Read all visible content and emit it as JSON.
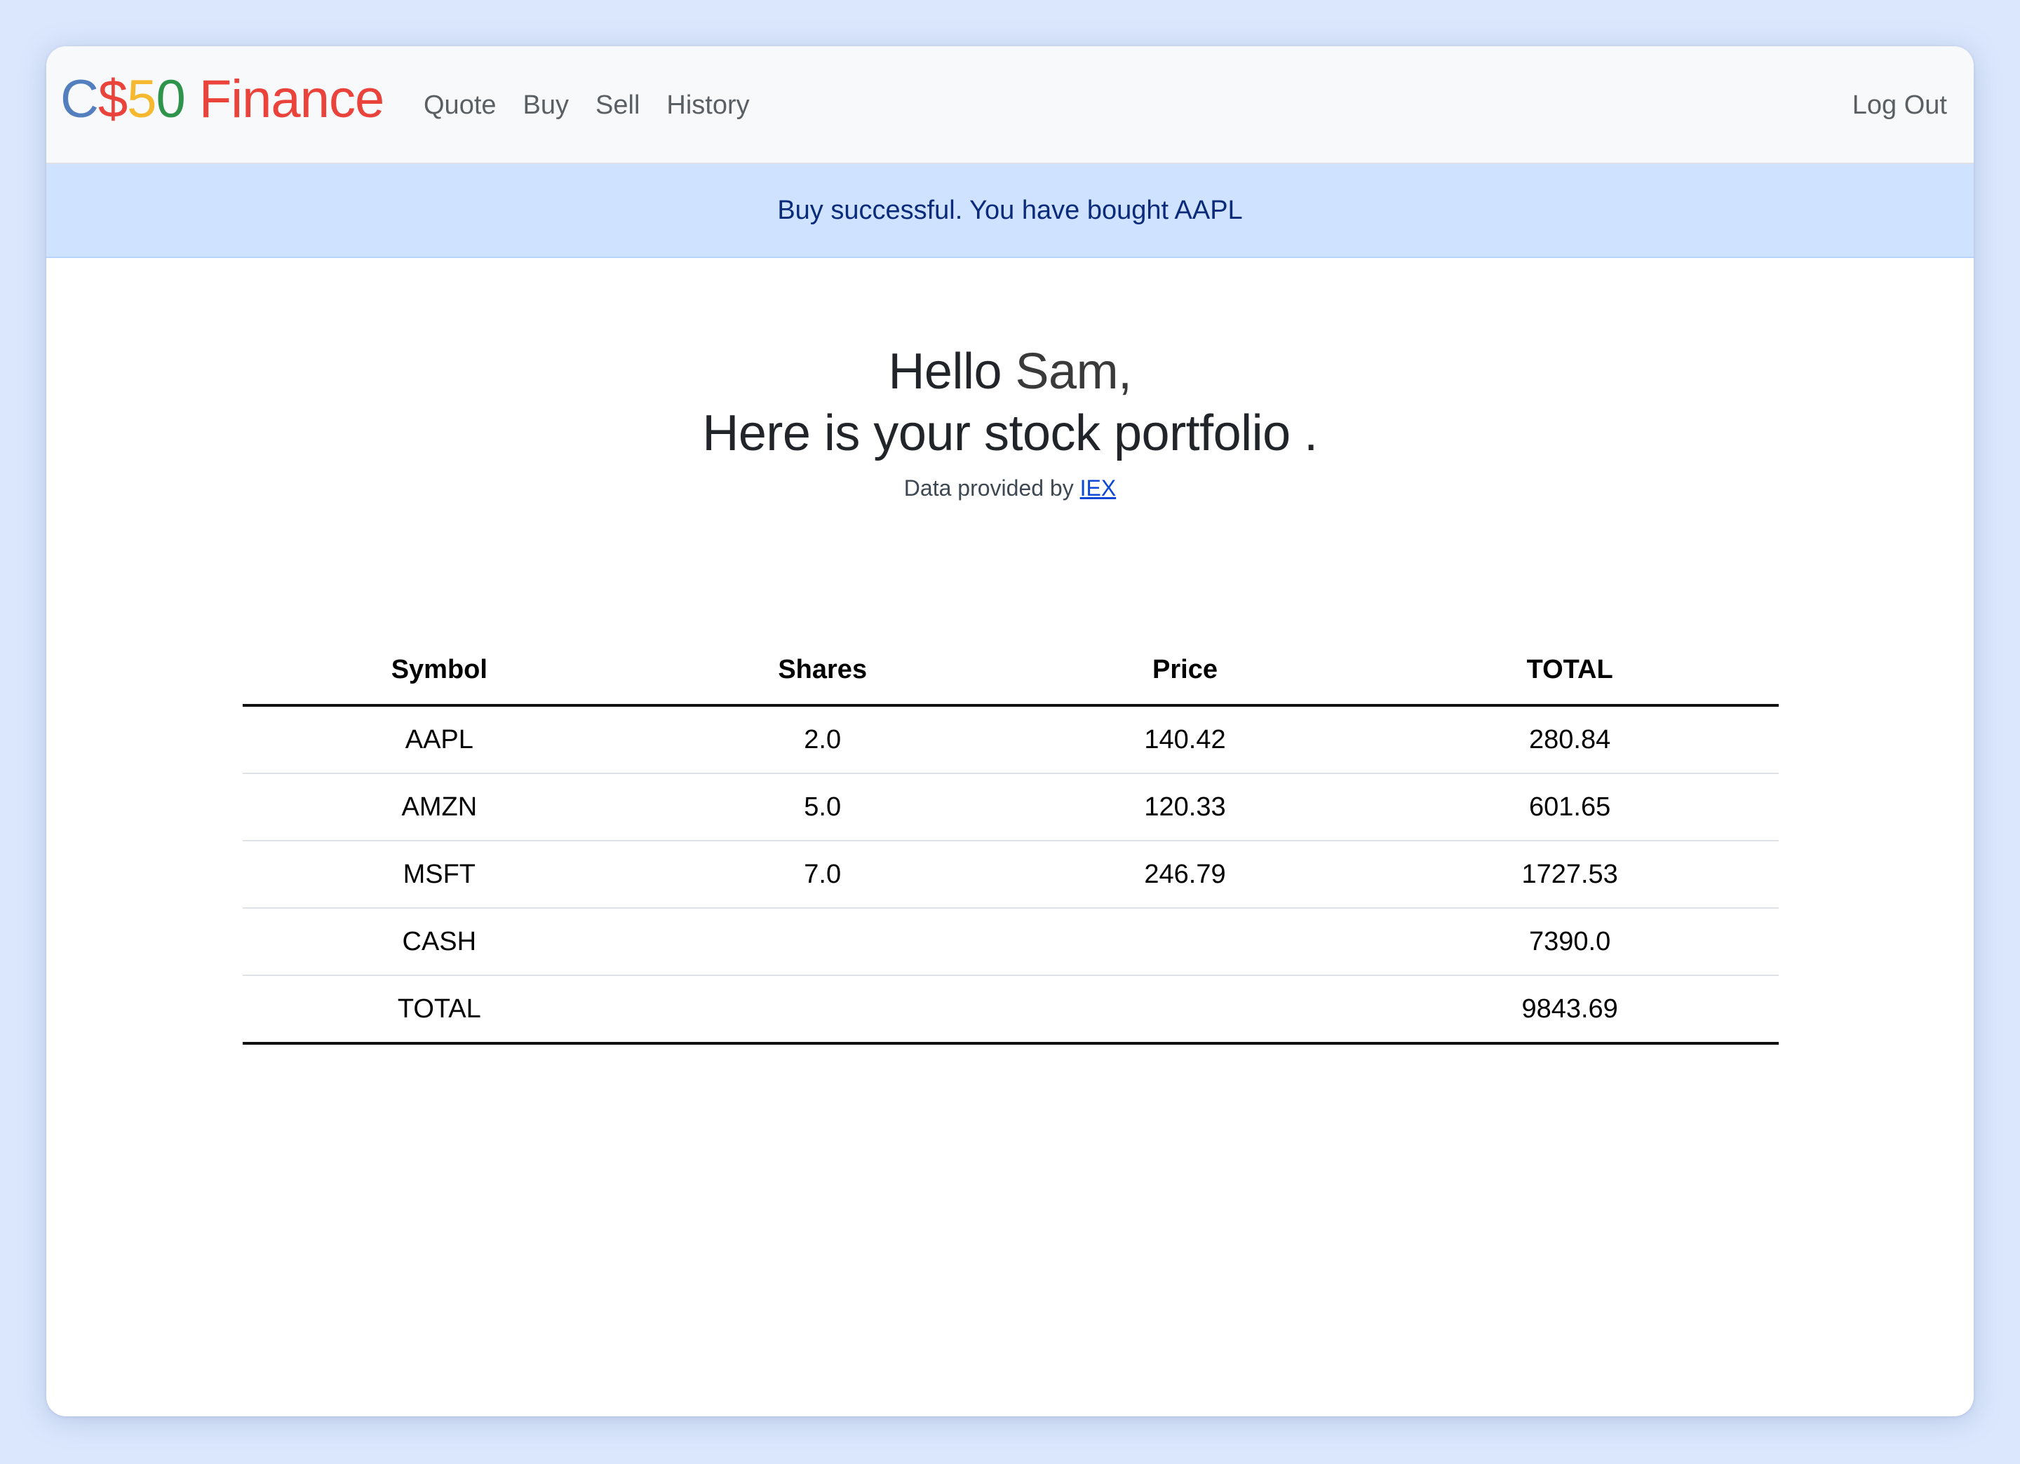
{
  "navbar": {
    "brand": {
      "c": "C",
      "dollar": "$",
      "five": "5",
      "zero": "0",
      "finance": "Finance"
    },
    "links": [
      "Quote",
      "Buy",
      "Sell",
      "History"
    ],
    "logout_label": "Log Out"
  },
  "alert": {
    "message": "Buy successful. You have bought AAPL"
  },
  "greeting": {
    "hello": "Hello ",
    "name": "Sam,",
    "subtitle": "Here is your stock portfolio .",
    "provided_text": "Data provided by ",
    "provided_link": "IEX"
  },
  "table": {
    "headers": [
      "Symbol",
      "Shares",
      "Price",
      "TOTAL"
    ],
    "rows": [
      [
        "AAPL",
        "2.0",
        "140.42",
        "280.84"
      ],
      [
        "AMZN",
        "5.0",
        "120.33",
        "601.65"
      ],
      [
        "MSFT",
        "7.0",
        "246.79",
        "1727.53"
      ],
      [
        "CASH",
        "",
        "",
        "7390.0"
      ],
      [
        "TOTAL",
        "",
        "",
        "9843.69"
      ]
    ]
  },
  "colors": {
    "page_background": "#dbe7fd",
    "navbar_background": "#f8f9fa",
    "alert_background": "#cfe2ff",
    "alert_text": "#0a2a7a",
    "link": "#0d47d6",
    "brand_blue": "#537fbe",
    "brand_red": "#ea433b",
    "brand_yellow": "#f5b82e",
    "brand_green": "#2e944b"
  }
}
